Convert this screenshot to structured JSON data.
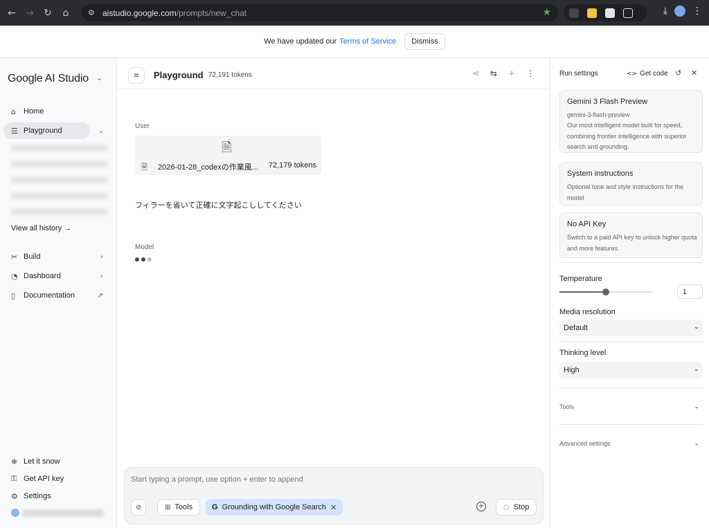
{
  "browser": {
    "url_host": "aistudio.google.com",
    "url_path": "/prompts/new_chat"
  },
  "banner": {
    "text": "We have updated our",
    "link": "Terms of Service",
    "dismiss": "Dismiss"
  },
  "sidebar": {
    "brand": "Google AI Studio",
    "home": "Home",
    "playground": "Playground",
    "view_all": "View all history →",
    "build": "Build",
    "dashboard": "Dashboard",
    "documentation": "Documentation",
    "let_it_snow": "Let it snow",
    "get_api_key": "Get API key",
    "settings": "Settings"
  },
  "main": {
    "title": "Playground",
    "tokens": "72,191 tokens",
    "user_label": "User",
    "file_name": "2026-01-28_codexの作業風...",
    "file_tokens": "72,179 tokens",
    "prompt": "フィラーを省いて正確に文字起こししてください",
    "model_label": "Model",
    "composer_placeholder": "Start typing a prompt, use option + enter to append",
    "tools_label": "Tools",
    "grounding_label": "Grounding with Google Search",
    "stop_label": "Stop"
  },
  "run_settings": {
    "title": "Run settings",
    "get_code": "Get code",
    "model_name": "Gemini 3 Flash Preview",
    "model_id": "gemini-3-flash-preview",
    "model_desc": "Our most intelligent model built for speed, combining frontier intelligence with superior search and grounding.",
    "sys_title": "System instructions",
    "sys_desc": "Optional tone and style instructions for the model",
    "api_title": "No API Key",
    "api_desc": "Switch to a paid API key to unlock higher quota and more features.",
    "temperature_label": "Temperature",
    "temperature_value": "1",
    "temperature_slider_fraction": 0.5,
    "media_label": "Media resolution",
    "media_value": "Default",
    "thinking_label": "Thinking level",
    "thinking_value": "High",
    "tools_label": "Tools",
    "advanced_label": "Advanced settings"
  }
}
